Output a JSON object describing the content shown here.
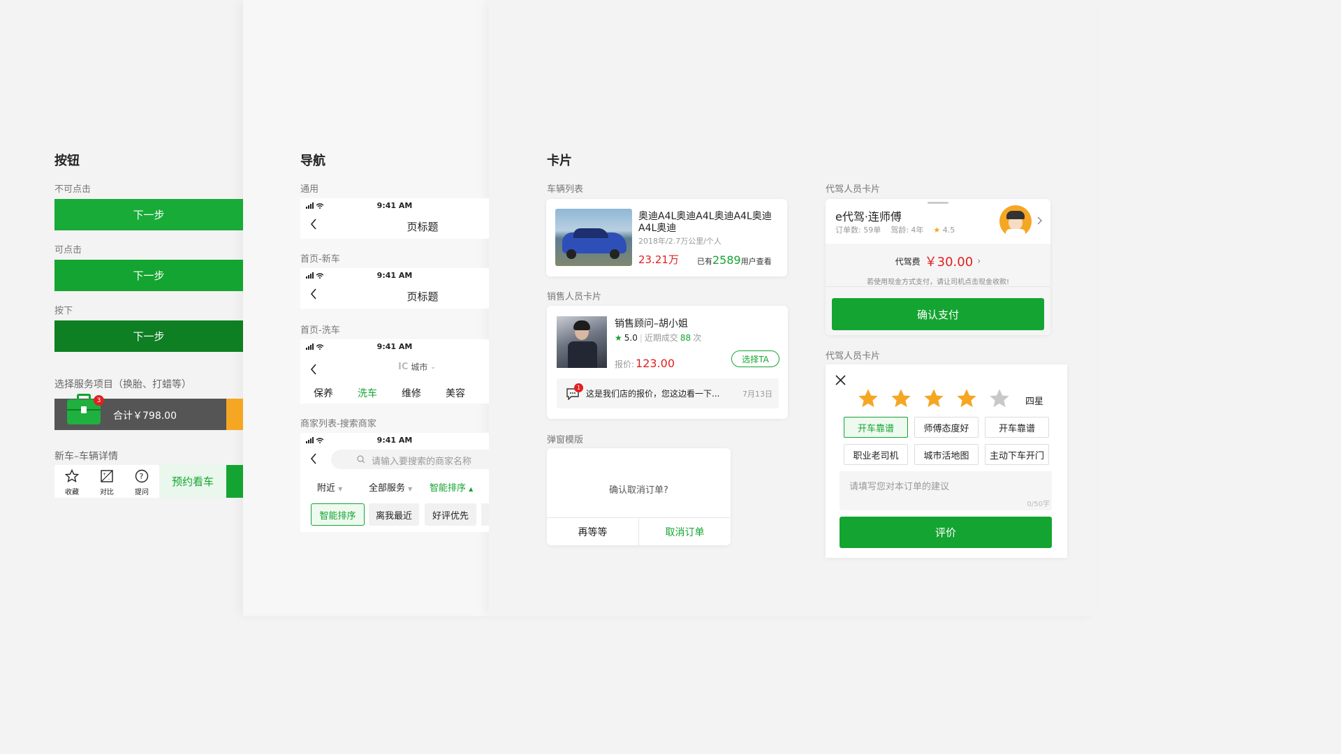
{
  "sections": {
    "buttons": "按钮",
    "nav": "导航",
    "cards": "卡片"
  },
  "buttons": {
    "disabled_label": "不可点击",
    "enabled_label": "可点击",
    "pressed_label": "按下",
    "next": "下一步",
    "service_label": "选择服务项目（换胎、打蜡等）",
    "cart_total": "合计￥798.00",
    "cart_badge": "3",
    "detail_label": "新车–车辆详情",
    "fav": "收藏",
    "compare": "对比",
    "ask": "提问",
    "book": "预约看车"
  },
  "nav": {
    "general": "通用",
    "home_new": "首页-新车",
    "home_wash": "首页-洗车",
    "merchant": "商家列表-搜索商家",
    "time": "9:41 AM",
    "page_title": "页标题",
    "city": "城市",
    "wash_tabs": [
      "保养",
      "洗车",
      "维修",
      "美容"
    ],
    "search_placeholder": "请输入要搜索的商家名称",
    "filters": [
      "附近",
      "全部服务",
      "智能排序"
    ],
    "sort_chips": [
      "智能排序",
      "离我最近",
      "好评优先"
    ]
  },
  "cards": {
    "vehicle_list": "车辆列表",
    "car_title": "奥迪A4L奥迪A4L奥迪A4L奥迪A4L奥迪",
    "car_meta": "2018年/2.7万公里/个人",
    "car_price": "23.21万",
    "car_views_pre": "已有",
    "car_views": "2589",
    "car_views_post": "用户查看",
    "sales_label": "销售人员卡片",
    "sales_name": "销售顾问–胡小姐",
    "sales_rating": "5.0",
    "sales_deals_pre": "近期成交",
    "sales_deals": "88",
    "sales_deals_post": "次",
    "sales_quote_label": "报价:",
    "sales_quote": "123.00",
    "sales_choose": "选择TA",
    "sales_msg_badge": "1",
    "sales_msg": "这是我们店的报价，您这边看一下...",
    "sales_date": "7月13日",
    "dialog_label": "弹窗模版",
    "dialog_text": "确认取消订单?",
    "dialog_wait": "再等等",
    "dialog_cancel": "取消订单",
    "driver_label": "代驾人员卡片",
    "driver_name": "e代驾·连师傅",
    "driver_orders": "订单数: 59单",
    "driver_years": "驾龄: 4年",
    "driver_rating": "4.5",
    "fee_label": "代驾费",
    "fee_value": "￥30.00",
    "fee_note": "若使用现金方式支付，请让司机点击现金收款!",
    "pay_btn": "确认支付",
    "driver_label2": "代驾人员卡片",
    "rating_text": "四星",
    "rating_value": 4,
    "rating_max": 5,
    "tags": [
      "开车靠谱",
      "师傅态度好",
      "开车靠谱",
      "职业老司机",
      "城市活地图",
      "主动下车开门"
    ],
    "comment_placeholder": "请填写您对本订单的建议",
    "comment_count": "0/50字",
    "evaluate": "评价"
  },
  "colors": {
    "brand_green": "#14a431",
    "pressed_green": "#0e7f23",
    "price_red": "#e02020",
    "orange": "#f5a623",
    "star_yellow": "#f5a623"
  }
}
